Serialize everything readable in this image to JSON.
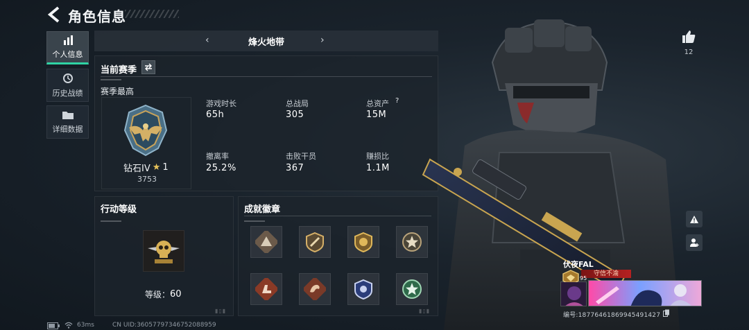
{
  "header": {
    "title": "角色信息"
  },
  "nav": [
    {
      "id": "personal",
      "label": "个人信息",
      "icon": "bar-chart-icon",
      "active": true
    },
    {
      "id": "history",
      "label": "历史战绩",
      "icon": "history-icon",
      "active": false
    },
    {
      "id": "details",
      "label": "详细数据",
      "icon": "folder-icon",
      "active": false
    }
  ],
  "mode": {
    "name": "烽火地带"
  },
  "season": {
    "title": "当前赛季",
    "subtitle": "赛季最高",
    "rank_name": "钻石IV",
    "rank_stars": "1",
    "rank_score": "3753",
    "stats": [
      {
        "label": "游戏时长",
        "value": "65h"
      },
      {
        "label": "总战局",
        "value": "305"
      },
      {
        "label": "总资产",
        "value": "15M"
      },
      {
        "label": "撤离率",
        "value": "25.2%"
      },
      {
        "label": "击败干员",
        "value": "367"
      },
      {
        "label": "赚损比",
        "value": "1.1M"
      }
    ],
    "help_glyph": "?"
  },
  "action_level": {
    "title": "行动等级",
    "level_label": "等级：",
    "level_value": "60"
  },
  "achievements": {
    "title": "成就徽章",
    "badges": [
      "triangle-badge-icon",
      "knife-shield-badge-icon",
      "gold-shield-badge-icon",
      "star-ring-badge-icon",
      "boot-badge-icon",
      "dragon-badge-icon",
      "blue-shield-badge-icon",
      "green-star-badge-icon"
    ]
  },
  "social": {
    "like_count": "12"
  },
  "player": {
    "name": "伏夜FAL",
    "tag": "守信不渝",
    "level": "95",
    "id_text": "编号:18776461869945491427"
  },
  "status_bar": {
    "ping": "63ms",
    "uid": "CN UID:3605779734675208895​9"
  },
  "colors": {
    "accent": "#2fd3a4",
    "tag": "#b52121",
    "background": "#1a232c"
  }
}
